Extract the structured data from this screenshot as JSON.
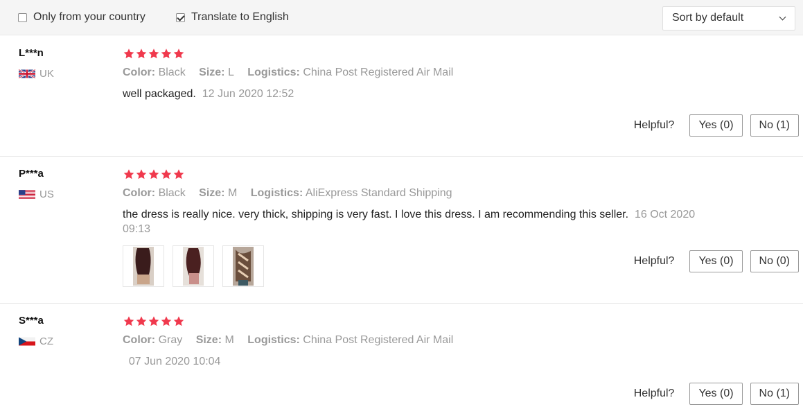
{
  "filters": {
    "only_country_label": "Only from your country",
    "only_country_checked": false,
    "translate_label": "Translate to English",
    "translate_checked": true,
    "sort_value": "Sort by default"
  },
  "labels": {
    "color": "Color:",
    "size": "Size:",
    "logistics": "Logistics:",
    "helpful": "Helpful?"
  },
  "colors": {
    "star": "#f0394d",
    "text_muted": "#999999"
  },
  "reviews": [
    {
      "user": "L***n",
      "flag_icon": "uk-flag-icon",
      "country": "UK",
      "stars": 5,
      "color": "Black",
      "size": "L",
      "logistics": "China Post Registered Air Mail",
      "text": "well packaged.",
      "date": "12 Jun 2020 12:52",
      "yes": "Yes (0)",
      "no": "No (1)"
    },
    {
      "user": "P***a",
      "flag_icon": "us-flag-icon",
      "country": "US",
      "stars": 5,
      "color": "Black",
      "size": "M",
      "logistics": "AliExpress Standard Shipping",
      "text": "the dress is really nice. very thick, shipping is very fast. I love this dress. I am recommending this seller.",
      "date": "16 Oct 2020 09:13",
      "yes": "Yes (0)",
      "no": "No (0)"
    },
    {
      "user": "S***a",
      "flag_icon": "cz-flag-icon",
      "country": "CZ",
      "stars": 5,
      "color": "Gray",
      "size": "M",
      "logistics": "China Post Registered Air Mail",
      "text": "",
      "date": "07 Jun 2020 10:04",
      "yes": "Yes (0)",
      "no": "No (1)"
    }
  ]
}
